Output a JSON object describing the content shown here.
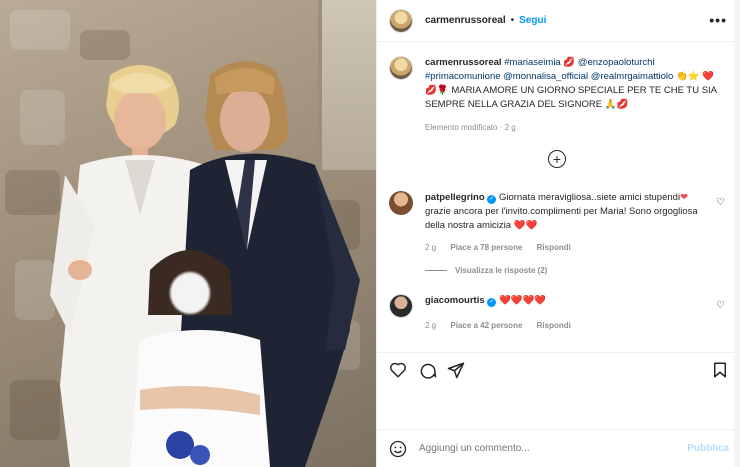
{
  "header": {
    "username": "carmenrussoreal",
    "separator": "•",
    "follow_label": "Segui",
    "more_icon": "more-horizontal-icon"
  },
  "caption": {
    "username": "carmenrussoreal",
    "hashtag1": "#mariaseimia",
    "emoji1": "💋",
    "mention1": "@enzopaoloturchi",
    "hashtag2": "#primacomunione",
    "mention2": "@monnalisa_official",
    "mention3": "@realmrgaimattiolo",
    "emoji2": "👏⭐",
    "emoji3": "❤️💋🌹",
    "body": "MARIA AMORE UN GIORNO SPECIALE PER TE CHE TU SIA SEMPRE NELLA GRAZIA DEL SIGNORE",
    "emoji4": "🙏💋",
    "edited": "Elemento modificato · 2 g"
  },
  "load_more_icon": "+",
  "comments": [
    {
      "username": "patpellegrino",
      "text": "Giornata meravigliosa..siete amici stupendi",
      "text2": "grazie ancora per l'invito.complimenti per Maria! Sono orgogliosa della nostra amicizia",
      "hearts_end": "❤️❤️",
      "time": "2 g",
      "likes": "Piace a 78 persone",
      "reply": "Rispondi",
      "view_replies": "Visualizza le risposte (2)"
    },
    {
      "username": "giacomourtis",
      "text": "❤️❤️❤️❤️",
      "time": "2 g",
      "likes": "Piace a 42 persone",
      "reply": "Rispondi"
    }
  ],
  "bottom": {
    "placeholder": "Aggiungi un commento...",
    "publish_label": "Pubblica"
  }
}
